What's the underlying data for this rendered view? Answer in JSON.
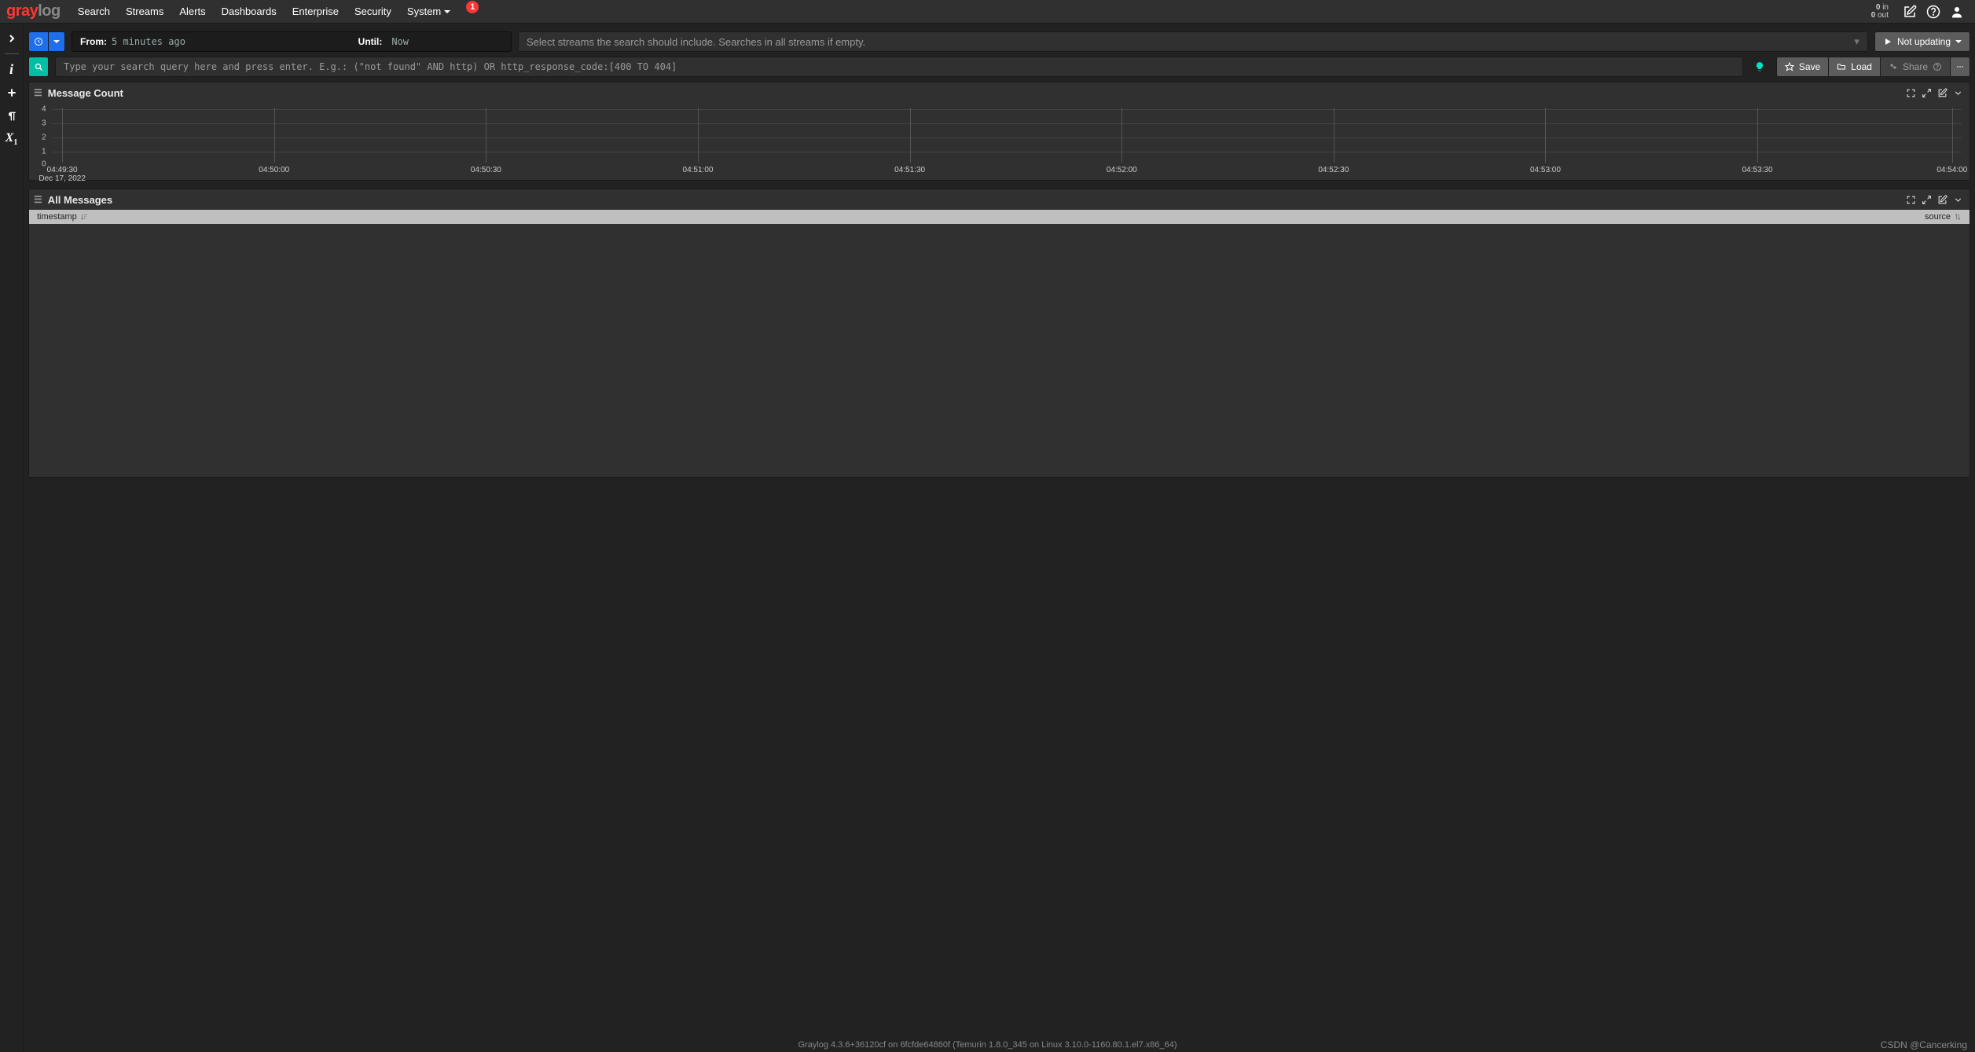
{
  "brand": "graylog",
  "nav": {
    "items": [
      "Search",
      "Streams",
      "Alerts",
      "Dashboards",
      "Enterprise",
      "Security",
      "System"
    ],
    "badge": "1",
    "throughput_in_n": "0",
    "throughput_in_u": "in",
    "throughput_out_n": "0",
    "throughput_out_u": "out"
  },
  "searchbar": {
    "from_label": "From:",
    "from_value": "5 minutes ago",
    "until_label": "Until:",
    "until_value": "Now",
    "streams_placeholder": "Select streams the search should include. Searches in all streams if empty.",
    "run_label": "Not updating",
    "query_placeholder": "Type your search query here and press enter. E.g.: (\"not found\" AND http) OR http_response_code:[400 TO 404]",
    "save_label": "Save",
    "load_label": "Load",
    "share_label": "Share"
  },
  "panels": {
    "count_title": "Message Count",
    "msgs_title": "All Messages",
    "col_ts": "timestamp",
    "col_src": "source"
  },
  "chart_data": {
    "type": "bar",
    "title": "Message Count",
    "xlabel": "",
    "ylabel": "",
    "ylim": [
      0,
      4
    ],
    "yticks": [
      0,
      1,
      2,
      3,
      4
    ],
    "x_date": "Dec 17, 2022",
    "categories": [
      "04:49:30",
      "04:50:00",
      "04:50:30",
      "04:51:00",
      "04:51:30",
      "04:52:00",
      "04:52:30",
      "04:53:00",
      "04:53:30",
      "04:54:00"
    ],
    "values": [
      0,
      0,
      0,
      0,
      0,
      0,
      0,
      0,
      0,
      0
    ]
  },
  "footer": {
    "version": "Graylog 4.3.6+36120cf on 6fcfde64860f (Temurin 1.8.0_345 on Linux 3.10.0-1160.80.1.el7.x86_64)"
  },
  "watermark": "CSDN @Cancerking"
}
